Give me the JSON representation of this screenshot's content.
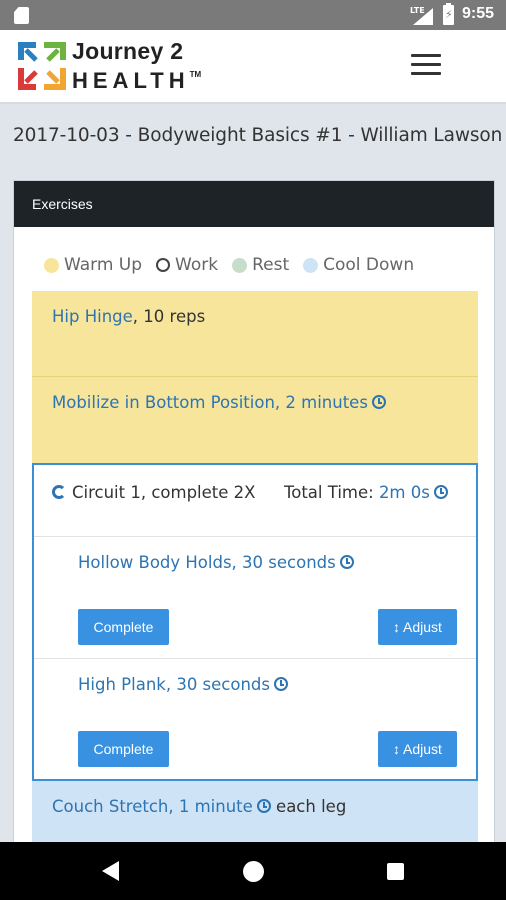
{
  "status": {
    "time": "9:55",
    "network": "LTE"
  },
  "brand": {
    "line1": "Journey 2",
    "line2": "HEALTH",
    "tm": "TM"
  },
  "title": "2017-10-03 - Bodyweight Basics #1 - William Lawson",
  "panel": {
    "header": "Exercises"
  },
  "legend": [
    {
      "label": "Warm Up",
      "color": "#f6e59a"
    },
    {
      "label": "Work",
      "color": "#ffffff"
    },
    {
      "label": "Rest",
      "color": "#c7ddc9"
    },
    {
      "label": "Cool Down",
      "color": "#cfe3f6"
    }
  ],
  "exercises": [
    {
      "name": "Hip Hinge",
      "detail": ", 10 reps"
    },
    {
      "name": "Mobilize in Bottom Position, 2 minutes"
    }
  ],
  "circuit": {
    "label": "Circuit 1, complete 2X",
    "total_label": "Total Time:",
    "total_value": "2m 0s",
    "items": [
      {
        "name": "Hollow Body Holds, 30 seconds",
        "complete": "Complete",
        "adjust": "Adjust"
      },
      {
        "name": "High Plank",
        "detail": ", 30 seconds",
        "complete": "Complete",
        "adjust": "Adjust"
      }
    ]
  },
  "cooldown": {
    "name": "Couch Stretch, 1 minute",
    "suffix": "each leg"
  },
  "icons": [
    "sd-card-icon",
    "signal-icon",
    "battery-icon",
    "hamburger-icon",
    "clock-icon",
    "refresh-icon",
    "adjust-arrows-icon",
    "back-icon",
    "home-icon",
    "recent-apps-icon"
  ]
}
